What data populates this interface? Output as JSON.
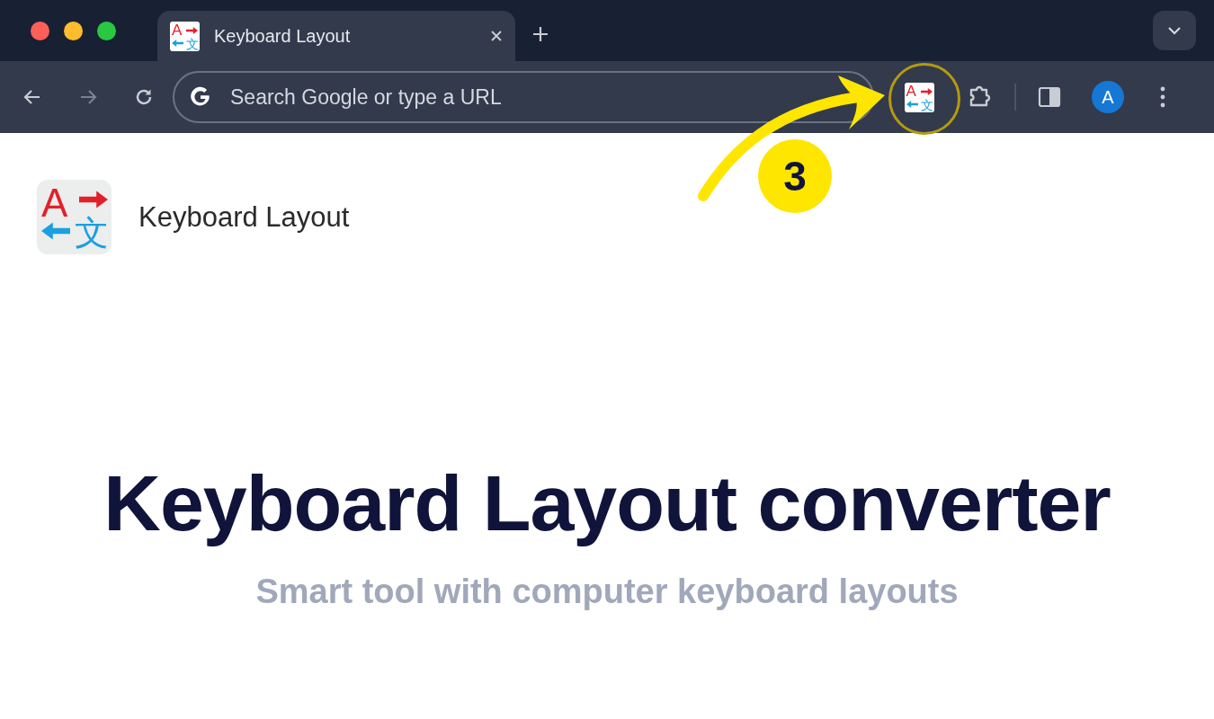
{
  "tabs": [
    {
      "title": "Keyboard Layout",
      "selected": true,
      "logo": {
        "letter": "A",
        "glyph": "文"
      }
    }
  ],
  "toolbar": {
    "placeholder": "Search Google or type a URL",
    "extension_logo": {
      "letter": "A",
      "glyph": "文"
    },
    "avatar": "A"
  },
  "annotation": {
    "step": "3"
  },
  "page": {
    "header": {
      "logo": {
        "letter": "A",
        "glyph": "文"
      },
      "title": "Keyboard Layout"
    },
    "headline": "Keyboard Layout converter",
    "subtitle": "Smart tool with computer keyboard layouts"
  }
}
